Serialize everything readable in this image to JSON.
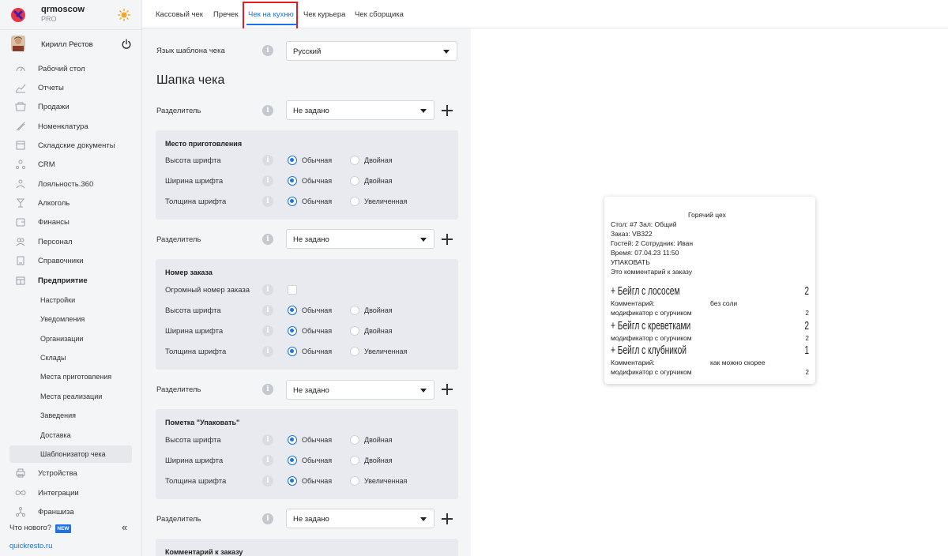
{
  "brand": {
    "name": "qrmoscow",
    "plan": "PRO"
  },
  "user": {
    "name": "Кирилл Рестов"
  },
  "colors": {
    "accent": "#1a73e8",
    "highlight": "#e21d24",
    "logo": "#e8344a"
  },
  "sidebar": {
    "items": [
      {
        "label": "Рабочий стол",
        "icon": "dashboard-icon"
      },
      {
        "label": "Отчеты",
        "icon": "chart-icon"
      },
      {
        "label": "Продажи",
        "icon": "cart-icon"
      },
      {
        "label": "Номенклатура",
        "icon": "tag-icon"
      },
      {
        "label": "Складские документы",
        "icon": "warehouse-icon"
      },
      {
        "label": "CRM",
        "icon": "crm-icon"
      },
      {
        "label": "Лояльность.360",
        "icon": "loyalty-icon"
      },
      {
        "label": "Алкоголь",
        "icon": "wine-glass-icon"
      },
      {
        "label": "Финансы",
        "icon": "wallet-icon"
      },
      {
        "label": "Персонал",
        "icon": "people-icon"
      },
      {
        "label": "Справочники",
        "icon": "book-icon"
      },
      {
        "label": "Предприятие",
        "icon": "building-icon"
      },
      {
        "label": "Настройки"
      },
      {
        "label": "Уведомления"
      },
      {
        "label": "Организации"
      },
      {
        "label": "Склады"
      },
      {
        "label": "Места приготовления"
      },
      {
        "label": "Места реализации"
      },
      {
        "label": "Заведения"
      },
      {
        "label": "Доставка"
      },
      {
        "label": "Шаблонизатор чека"
      },
      {
        "label": "Устройства",
        "icon": "printer-icon"
      },
      {
        "label": "Интеграции",
        "icon": "infinity-icon"
      },
      {
        "label": "Франшиза",
        "icon": "network-icon"
      }
    ],
    "whats_new": "Что нового?",
    "new_badge": "NEW",
    "collapse": "«",
    "site_link": "quickresto.ru"
  },
  "tabs": [
    {
      "label": "Кассовый чек"
    },
    {
      "label": "Пречек"
    },
    {
      "label": "Чек на кухню"
    },
    {
      "label": "Чек курьера"
    },
    {
      "label": "Чек сборщика"
    }
  ],
  "form": {
    "language_label": "Язык шаблона чека",
    "language_value": "Русский",
    "header_title": "Шапка чека",
    "separator_label": "Разделитель",
    "separator_value": "Не задано",
    "font_height": "Высота шрифта",
    "font_width": "Ширина шрифта",
    "font_weight": "Толщина шрифта",
    "opt_normal": "Обычная",
    "opt_double": "Двойная",
    "opt_bold": "Увеличенная",
    "section1": "Место приготовления",
    "section2": "Номер заказа",
    "huge_order_number": "Огромный номер заказа",
    "section3": "Пометка \"Упаковать\"",
    "section4": "Комментарий к заказу",
    "info_glyph": "i"
  },
  "receipt": {
    "title": "Горячий цех",
    "table_line": "Стол: #7 Зал: Общий",
    "order_line": "Заказ: VB322",
    "guests_line": "Гостей: 2 Сотрудник: Иван",
    "time_line": "Время: 07.04.23 11:50",
    "pack_line": "УПАКОВАТЬ",
    "comment_line": "Это комментарий к заказу",
    "items": [
      {
        "name": "+ Бейгл с лососем",
        "qty": "2",
        "comment_label": "Комментарий:",
        "comment": "без соли",
        "modifier": "модификатор с огурчиком",
        "modifier_qty": "2"
      },
      {
        "name": "+ Бейгл с креветками",
        "qty": "2",
        "modifier": "модификатор с огурчиком",
        "modifier_qty": "2"
      },
      {
        "name": "+ Бейгл с клубникой",
        "qty": "1",
        "comment_label": "Комментарий:",
        "comment": "как можно скорее",
        "modifier": "модификатор с огурчиком",
        "modifier_qty": "2"
      }
    ]
  }
}
